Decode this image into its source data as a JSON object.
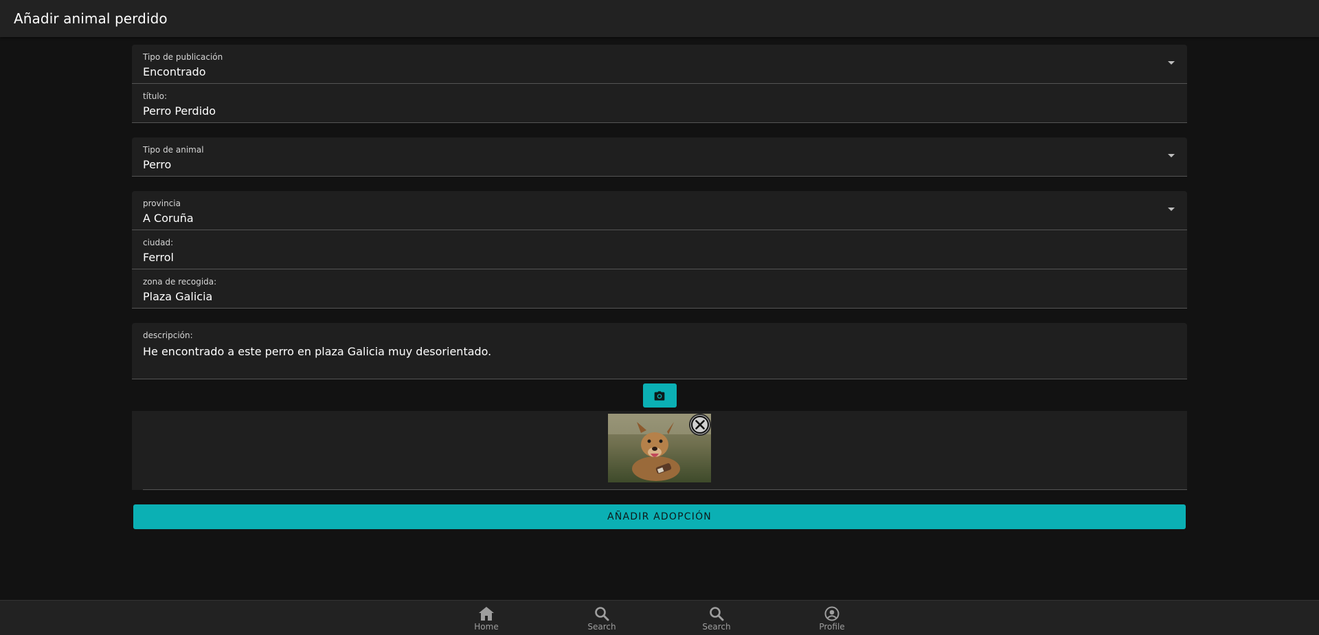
{
  "app_bar": {
    "title": "Añadir animal perdido"
  },
  "form": {
    "publication_type": {
      "label": "Tipo de publicación",
      "value": "Encontrado"
    },
    "title": {
      "label": "título:",
      "value": "Perro Perdido"
    },
    "animal_type": {
      "label": "Tipo de animal",
      "value": "Perro"
    },
    "province": {
      "label": "provincia",
      "value": "A Coruña"
    },
    "city": {
      "label": "ciudad:",
      "value": "Ferrol"
    },
    "pickup_zone": {
      "label": "zona de recogida:",
      "value": "Plaza Galicia"
    },
    "description": {
      "label": "descripción:",
      "value": "He encontrado a este perro en plaza Galicia muy desorientado."
    },
    "camera_icon": "camera-icon",
    "submit_label": "AÑADIR ADOPCIÓN"
  },
  "bottom_nav": {
    "items": [
      {
        "label": "Home",
        "icon": "home-icon"
      },
      {
        "label": "Search",
        "icon": "search-icon"
      },
      {
        "label": "Search",
        "icon": "search-icon"
      },
      {
        "label": "Profile",
        "icon": "account-circle-icon"
      }
    ]
  },
  "colors": {
    "accent": "#0bb0b4",
    "background": "#121212",
    "surface": "#1f1f1f",
    "app_bar": "#222222"
  }
}
